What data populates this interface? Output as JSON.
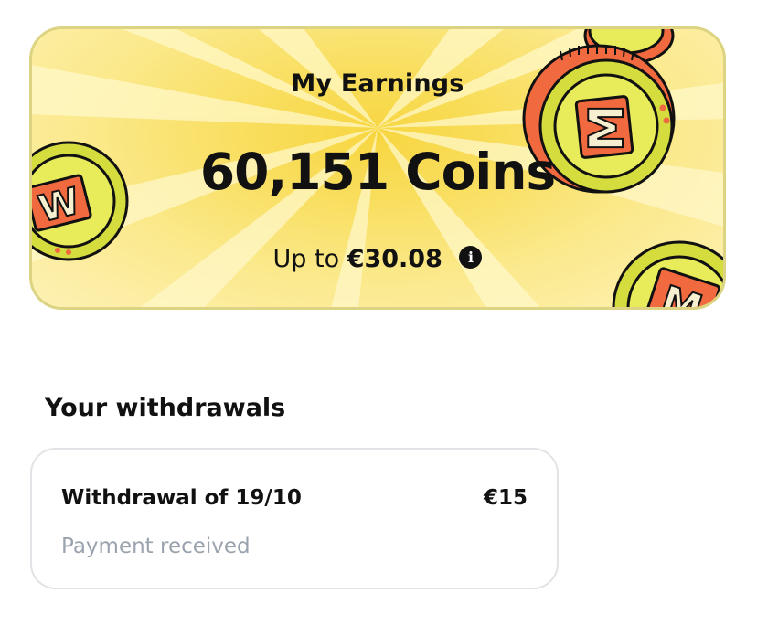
{
  "earnings": {
    "title": "My Earnings",
    "coins": "60,151 Coins",
    "eur_prefix": "Up to",
    "eur_value": "€30.08",
    "info_icon": "info-icon",
    "colors": {
      "background": "#f9df62",
      "coin_rim": "#d9e14a",
      "coin_face": "#e9ec5c",
      "coin_badge": "#f0693f",
      "border": "#dcd483"
    }
  },
  "withdrawals": {
    "section_title": "Your withdrawals",
    "items": [
      {
        "title": "Withdrawal of 19/10",
        "amount": "€15",
        "status": "Payment received"
      }
    ]
  }
}
